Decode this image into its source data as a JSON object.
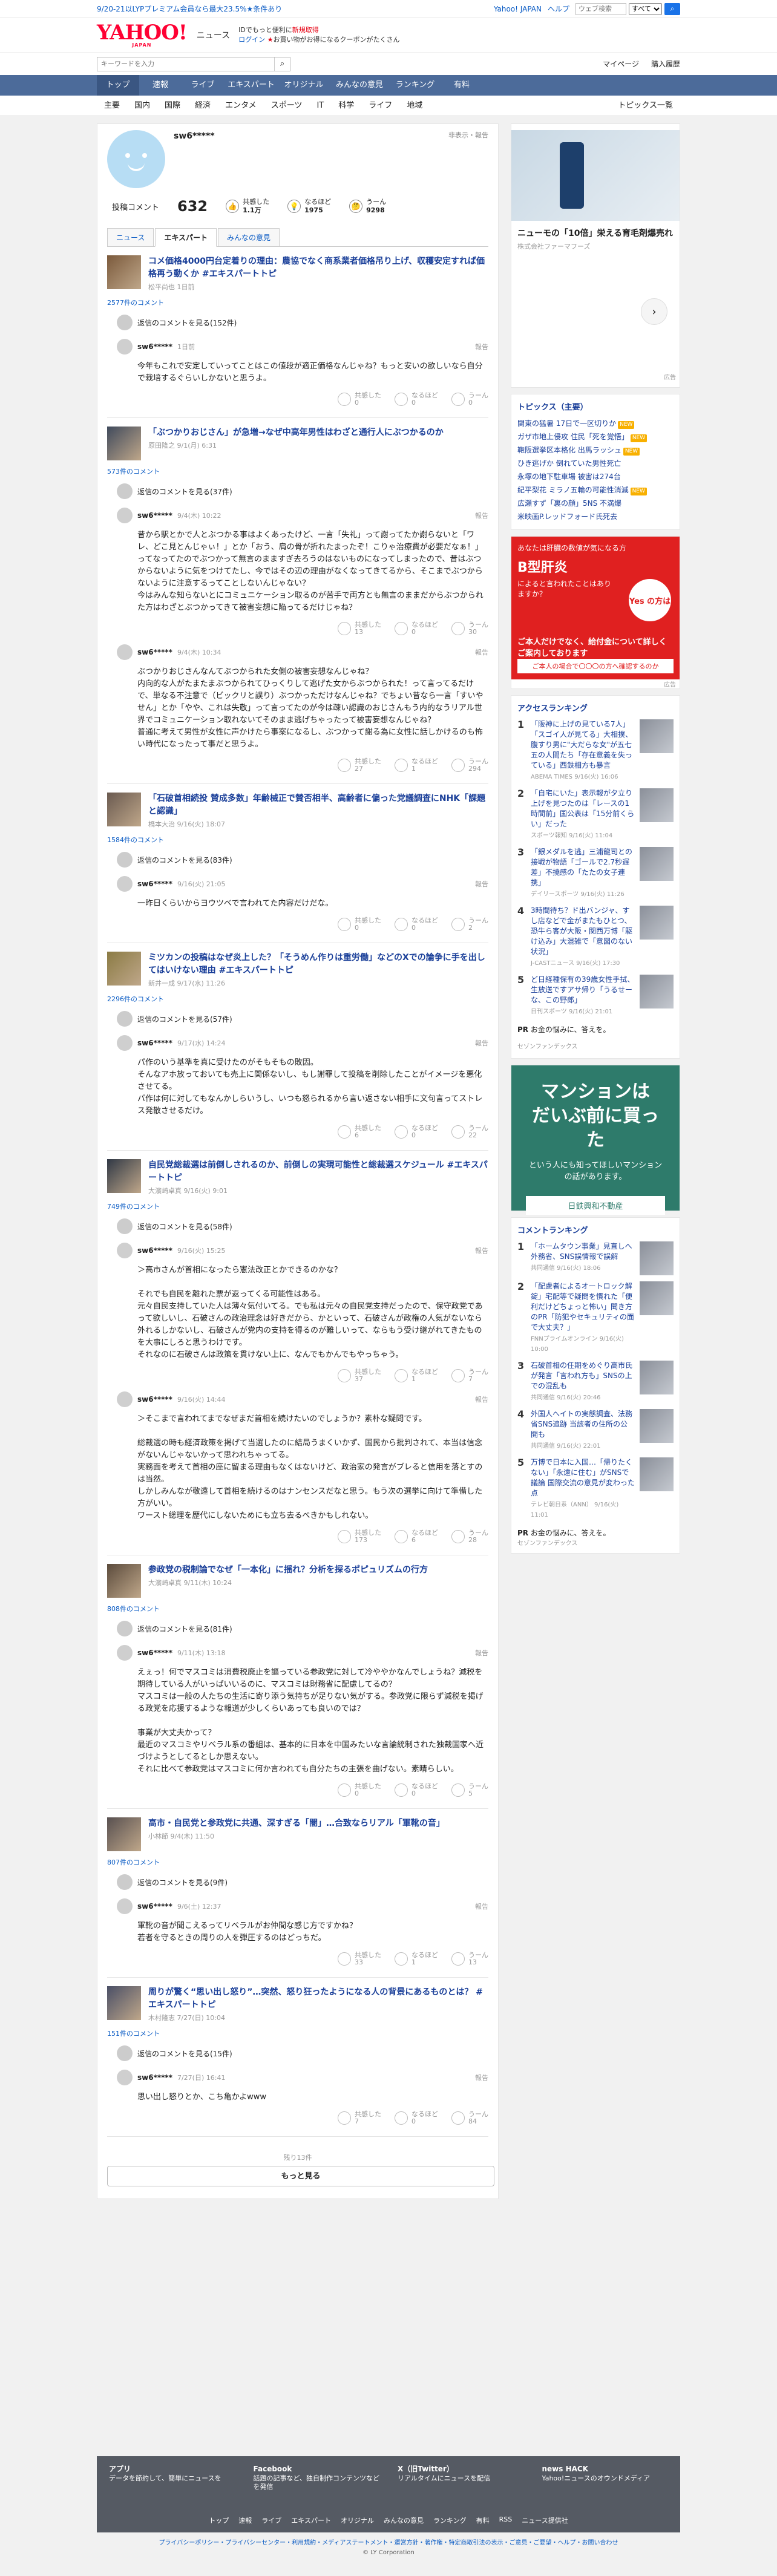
{
  "topbar": {
    "promo": "9/20-21以LYPプレミアム会員なら最大23.5%★条件あり",
    "links": [
      "Yahoo! JAPAN",
      "ヘルプ"
    ],
    "search_placeholder": "ウェブ検索",
    "scope": "すべて"
  },
  "header": {
    "logo": "YAHOO!",
    "logo_sub": "JAPAN",
    "section": "ニュース",
    "promo_line1": "IDでもっと便利に",
    "promo_new": "新規取得",
    "promo_login": "ログイン",
    "promo_line2": "お買い物がお得になるクーポンがたくさん"
  },
  "searchrow": {
    "placeholder": "キーワードを入力",
    "links": [
      "マイページ",
      "購入履歴"
    ]
  },
  "gnav": [
    "トップ",
    "速報",
    "ライブ",
    "エキスパート",
    "オリジナル",
    "みんなの意見",
    "ランキング",
    "有料"
  ],
  "cnav": {
    "items": [
      "主要",
      "国内",
      "国際",
      "経済",
      "エンタメ",
      "スポーツ",
      "IT",
      "科学",
      "ライフ",
      "地域"
    ],
    "trend": "トピックス一覧"
  },
  "profile": {
    "name": "sw6*****",
    "privacy": "非表示・報告",
    "comments_label": "投稿コメント",
    "comments": "632",
    "stats": [
      {
        "label": "共感した",
        "value": "1.1万"
      },
      {
        "label": "なるほど",
        "value": "1975"
      },
      {
        "label": "うーん",
        "value": "9298"
      }
    ]
  },
  "tabs": [
    "ニュース",
    "エキスパート",
    "みんなの意見"
  ],
  "articles": [
    {
      "title": "コメ価格4000円台定着りの理由：農協でなく商系業者価格吊り上げ、収穫安定すれば価格再う動くか #エキスパートトピ",
      "source": "松平尚也 1日前",
      "count": "2577件のコメント",
      "orig": "返信のコメントを見る(152件)",
      "comments": [
        {
          "name": "sw6*****",
          "date": "1日前",
          "body": "今年もこれで安定していってことはこの値段が適正価格なんじゃね？もっと安いの欲しいなら自分で栽培するぐらいしかないと思うよ。",
          "r": [
            "0",
            "0",
            "0"
          ]
        }
      ]
    },
    {
      "title": "「ぶつかりおじさん」が急増→なぜ中高年男性はわざと通行人にぶつかるのか",
      "source": "原田隆之 9/1(月) 6:31",
      "count": "573件のコメント",
      "orig": "返信のコメントを見る(37件)",
      "comments": [
        {
          "name": "sw6*****",
          "date": "9/4(木) 10:22",
          "body": "昔から駅とかで人とぶつかる事はよくあったけど、一言「失礼」って謝ってたか謝らないと「ワレ、どこ見とんじゃぃ！」とか「おう、肩の骨が折れたまったぞ！こりゃ治療費が必要だなぁ！」ってなってたのでぶつかって無言のまますぎ去ろうのはないものになってしまったので、昔はぶつからないように気をつけてたし、今ではその辺の理由がなくなってきてるから、そこまでぶつからないように注意するってことしないんじゃない？\n今はみんな知らないとにコミュニケーション取るのが苦手で両方とも無言のままだからぶつかられた方はわざとぶつかってきて被害妄想に陥ってるだけじゃね？",
          "r": [
            "13",
            "0",
            "30"
          ]
        },
        {
          "name": "sw6*****",
          "date": "9/4(木) 10:34",
          "body": "ぶつかりおじさんなんてぶつかられた女側の被害妄想なんじゃね？\n内向的な人がたまたまぶつかられてひっくりして逃げた女からぶつかられた！って言ってるだけで、単なる不注意で（ビックリと誤り）ぶつかっただけなんじゃね？でちょい昔なら一言「すいやせん」とか「やや、これは失敬」って言ってたのが今は疎い認識のおじさんもう内的なうリアル世界でコミュニケーション取れないてそのまま逃げちゃったって被害妄想なんじゃね？\n普通に考えて男性が女性に声かけたら事案になるし、ぶつかって謝る為に女性に話しかけるのも怖い時代になったって事だと思うよ。",
          "r": [
            "27",
            "1",
            "294"
          ]
        }
      ]
    },
    {
      "title": "「石破首相続投 賛成多数」年齢械正で賛否相半、高齢者に偏った党議調査にNHK「課題と認識」",
      "source": "橋本大治 9/16(火) 18:07",
      "count": "1584件のコメント",
      "orig": "返信のコメントを見る(83件)",
      "comments": [
        {
          "name": "sw6*****",
          "date": "9/16(火) 21:05",
          "body": "一昨日くらいからヨウツべで言われてた内容だけだな。",
          "r": [
            "0",
            "0",
            "2"
          ]
        }
      ]
    },
    {
      "title": "ミツカンの投稿はなぜ炎上した？「そうめん作りは重労働」などのXでの論争に手を出してはいけない理由 #エキスパートトピ",
      "source": "新井一成 9/17(水) 11:26",
      "count": "2296件のコメント",
      "orig": "返信のコメントを見る(57件)",
      "comments": [
        {
          "name": "sw6*****",
          "date": "9/17(水) 14:24",
          "body": "パ作のいう基準を真に受けたのがそもそもの敗因。\nそんなアホ放っておいても売上に関係ないし、もし謝罪して投稿を削除したことがイメージを悪化させてる。\nパ作は何に対してもなんかしらいうし、いつも怒られるから言い返さない相手に文句言ってストレス発散させるだけ。",
          "r": [
            "6",
            "0",
            "22"
          ]
        }
      ]
    },
    {
      "title": "自民党総裁選は前倒しされるのか、前倒しの実現可能性と総裁選スケジュール #エキスパートトピ",
      "source": "大濱崎卓真 9/16(火) 9:01",
      "count": "749件のコメント",
      "orig": "返信のコメントを見る(58件)",
      "comments": [
        {
          "name": "sw6*****",
          "date": "9/16(火) 15:25",
          "body": "＞高市さんが首相になったら憲法改正とかできるのかな？\n\nそれでも自民を離れた票が返ってくる可能性はある。\n元々自民支持していた人は薄々気付いてる。でも私は元々の自民党支持だったので、保守政党であって欲しいし、石破さんの政治理念は好きだから、かといって、石破さんが政権の人気がないなら外れるしかないし、石破さんが党内の支持を得るのが難しいって、ならもう受け継がれてきたものを大事にしろと思うわけです。\nそれなのに石破さんは政策を貫けない上に、なんでもかんでもやっちゃう。",
          "r": [
            "37",
            "1",
            "7"
          ]
        },
        {
          "name": "sw6*****",
          "date": "9/16(火) 14:44",
          "body": "＞そこまで言われてまでなぜまだ首相を続けたいのでしょうか？素朴な疑問です。\n\n総裁選の時も経済政策を掲げて当選したのに結局うまくいかず、国民から批判されて、本当は信念がないんじゃないかって思われちゃってる。\n実務面を考えて首相の座に留まる理由もなくはないけど、政治家の発言がブレると信用を落とすのは当然。\nしかしみんなが敬遠して首相を続けるのはナンセンスだなと思う。もう次の選挙に向けて準備した方がいい。\nワースト総理を歴代にしないためにも立ち去るべきかもしれない。",
          "r": [
            "173",
            "6",
            "28"
          ]
        }
      ]
    },
    {
      "title": "参政党の税制論でなぜ「一本化」に揺れ？分析を探るポピュリズムの行方",
      "source": "大濱崎卓真 9/11(木) 10:24",
      "count": "808件のコメント",
      "orig": "返信のコメントを見る(81件)",
      "comments": [
        {
          "name": "sw6*****",
          "date": "9/11(木) 13:18",
          "body": "えぇっ！何でマスコミは消費税廃止を謳っている参政党に対して冷ややかなんでしょうね？減税を期待している人がいっぱいいるのに、マスコミは財務省に配慮してるの？\nマスコミは一般の人たちの生活に寄り添う気持ちが足りない気がする。参政党に限らず減税を掲げる政党を応援するような報道が少しくらいあっても良いのでは？\n\n事業が大丈夫かって？\n最近のマスコミやリベラル系の番組は、基本的に日本を中国みたいな言論統制された独裁国家へ近づけようとしてるとしか思えない。\nそれに比べて参政党はマスコミに何か言われても自分たちの主張を曲げない。素晴らしい。",
          "r": [
            "0",
            "0",
            "5"
          ]
        }
      ]
    },
    {
      "title": "高市・自民党と参政党に共通、深すぎる「闇」…合致ならリアル「軍靴の音」",
      "source": "小林節 9/4(木) 11:50",
      "count": "807件のコメント",
      "orig": "返信のコメントを見る(9件)",
      "comments": [
        {
          "name": "sw6*****",
          "date": "9/6(土) 12:37",
          "body": "軍靴の音が聞こえるってリベラルがお仲間な感じ方ですかね？\n若者を守るときの周りの人を弾圧するのはどっちだ。",
          "r": [
            "33",
            "1",
            "13"
          ]
        }
      ]
    },
    {
      "title": "周りが驚く“思い出し怒り”…突然、怒り狂ったようになる人の背景にあるものとは？ #エキスパートトピ",
      "source": "木村隆志 7/27(日) 10:04",
      "count": "151件のコメント",
      "orig": "返信のコメントを見る(15件)",
      "comments": [
        {
          "name": "sw6*****",
          "date": "7/27(日) 16:41",
          "body": "思い出し怒りとか、こち亀かよwww",
          "r": [
            "7",
            "0",
            "84"
          ]
        }
      ]
    }
  ],
  "more": {
    "count": "残り13件",
    "label": "もっと見る"
  },
  "side": {
    "ad1": {
      "title": "ニューモの「10倍」栄える育毛剤爆売れ",
      "company": "株式会社ファーマフーズ",
      "label": "広告"
    },
    "topics_title": "トピックス（主要）",
    "topics": [
      "関東の猛暑 17日で一区切りか",
      "ガザ市地上侵攻 住民「死を覚悟」",
      "鞄阪選挙区本格化 出馬ラッシュ",
      "ひき逃げか 倒れていた男性死亡",
      "永塚の地下駐車場 被害は274台",
      "紀平梨花 ミラノ五輪の可能性消滅",
      "広瀬すず「裏の顔」5NS 不満爆",
      "米映画P.レッドフォード氏死去"
    ],
    "ad2": {
      "top": "あなたは肝臓の数値が気になる方",
      "mid": "B型肝炎",
      "question": "によると言われたことはありますか？",
      "yes": "Yes の方は",
      "cta": "ご本人だけでなく、給付金について詳しくご案内しております",
      "foot": "ご本人の場合で〇〇〇の方へ確認するのか",
      "label": "広告"
    },
    "access_title": "アクセスランキング",
    "access": [
      {
        "t": "「阪神に上げの見ている7人」「スゴイ人が見てる」大相撲、腹すり男に\"大だらな女\"が五七五の人間たち「存在意義を失っている」西鉄相方も暴言",
        "m": "ABEMA TIMES 9/16(火) 16:06"
      },
      {
        "t": "「自宅にいた」表示報が夕立り上げを見つたのは「レースの1時間前」国公表は「15分前くらい」だった",
        "m": "スポーツ報知 9/16(火) 11:04"
      },
      {
        "t": "「銀メダルを逃」三浦龍司との接戦が物語「ゴールで2.7秒遅差」不撓感の「たたの女子連携」",
        "m": "デイリースポーツ 9/16(火) 11:26"
      },
      {
        "t": "3時間待ち？ド出バンジャ、すし店などで金がまたもひとつ、恐牛ら客が大阪・関西万博「駆け込み」大混雑で「意図のない状況」",
        "m": "J-CASTニュース 9/16(火) 17:30"
      },
      {
        "t": "ど日経種保有の39歳女性手拭、生放送ですアサ帰り「うるせーな、この野郎」",
        "m": "日刊スポーツ 9/16(火) 21:01"
      }
    ],
    "ad_pr": {
      "t": "お金の悩みに、答えを。",
      "c": "セゾンファンデックス"
    },
    "ad3": {
      "line1": "マンションは",
      "line2": "だいぶ前に買った",
      "line3": "という人にも知ってほしいマンションの話があります。",
      "brand": "日鉄興和不動産"
    },
    "comment_title": "コメントランキング",
    "comment_rank": [
      {
        "t": "「ホームタウン事業」見直しへ外務省、SNS誤情報で誤解",
        "m": "共同通信 9/16(火) 18:06"
      },
      {
        "t": "「配慮者によるオートロック解錠」宅配等で疑問を慣れた「便利だけどちょっと怖い」聞き方のPR「防犯やセキュリティの面で大丈夫？」",
        "m": "FNNプライムオンライン 9/16(火) 10:00"
      },
      {
        "t": "石破首相の任期をめぐり高市氏が発言「言われ方も」SNSの上での混乱も",
        "m": "共同通信 9/16(火) 20:46"
      },
      {
        "t": "外国人へイトの実態調査、法務省SNS追跡 当該者の住所の公開も",
        "m": "共同通信 9/16(火) 22:01"
      },
      {
        "t": "万博で日本に入国…「帰りたくない」「永遠に住む」がSNSで議論 国際交流の意見が変わった点",
        "m": "テレビ朝日系（ANN） 9/16(火) 11:01"
      }
    ],
    "ad_pr2": {
      "t": "お金の悩みに、答えを。",
      "c": "セゾンファンデックス"
    }
  },
  "footer": {
    "cols": [
      {
        "h": "アプリ",
        "d": "データを節約して、簡単にニュースを"
      },
      {
        "h": "Facebook",
        "d": "話題の記事など、独自制作コンテンツなどを発信"
      },
      {
        "h": "X（旧Twitter）",
        "d": "リアルタイムにニュースを配信"
      },
      {
        "h": "news HACK",
        "d": "Yahoo!ニュースのオウンドメディア"
      }
    ],
    "links": [
      "トップ",
      "速報",
      "ライブ",
      "エキスパート",
      "オリジナル",
      "みんなの意見",
      "ランキング",
      "有料",
      "RSS",
      "ニュース提供社"
    ],
    "bottom": "プライバシーポリシー・プライバシーセンター・利用規約・メディアステートメント・運営方針・著作権・特定商取引法の表示・ご意見・ご要望・ヘルプ・お問い合わせ",
    "copy": "© LY Corporation"
  }
}
